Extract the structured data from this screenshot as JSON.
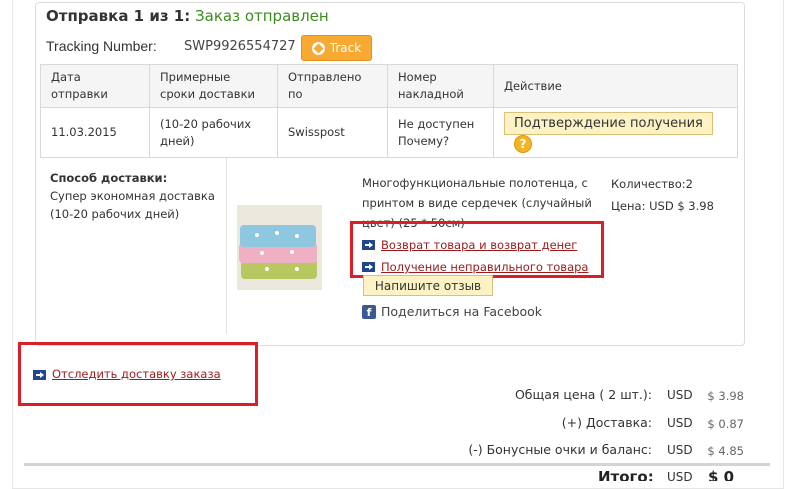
{
  "shipment": {
    "title_count": "Отправка 1 из 1:",
    "title_status": "Заказ отправлен",
    "tracking_label": "Tracking Number:",
    "tracking_number": "SWP9926554727",
    "track_button": "Track"
  },
  "table": {
    "headers": [
      "Дата отправки",
      "Примерные сроки доставки",
      "Отправлено по",
      "Номер накладной",
      "Действие"
    ],
    "row": {
      "date": "11.03.2015",
      "delivery_time": "(10-20 рабочих дней)",
      "carrier": "Swisspost",
      "waybill": "Не доступен Почему?",
      "action_button": "Подтверждение получения",
      "help": "?"
    }
  },
  "delivery_method": {
    "label": "Способ доставки:",
    "text": "Супер экономная доставка (10-20 рабочих дней)"
  },
  "product": {
    "description": "Многофункциональные полотенца, с принтом в виде сердечек (случайный цвет) (25 * 50см)",
    "quantity": "Количество:2",
    "price": "Цена: USD $ 3.98",
    "return_link": "Возврат товара и возврат денег",
    "wrong_item_link": "Получение неправильного товара",
    "review_button": "Напишите отзыв",
    "facebook_share": "Поделиться на Facebook"
  },
  "track_order_link": "Отследить доставку заказа",
  "summary": [
    {
      "label": "Общая цена ( 2 шт.):",
      "currency": "USD",
      "value": "$ 3.98"
    },
    {
      "label": "(+) Доставка:",
      "currency": "USD",
      "value": "$ 0.87"
    },
    {
      "label": "(-) Бонусные очки и баланс:",
      "currency": "USD",
      "value": "$ 4.85"
    }
  ],
  "total": {
    "label": "Итого:",
    "currency": "USD",
    "value": "$ 0"
  },
  "colors": {
    "status_green": "#3b8e1c",
    "track_orange": "#f7a932",
    "highlight_red": "#d92029",
    "link_red": "#9b1b1b"
  }
}
